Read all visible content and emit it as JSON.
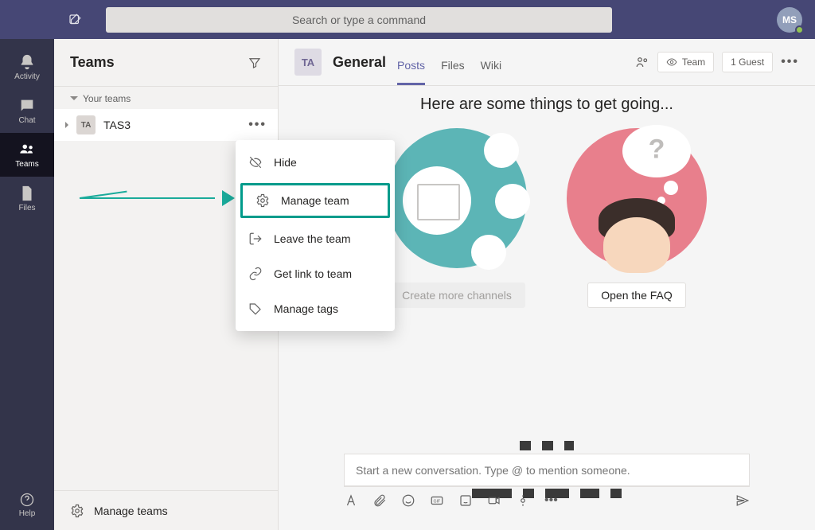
{
  "topbar": {
    "search_placeholder": "Search or type a command",
    "user_initials": "MS"
  },
  "rail": {
    "items": [
      {
        "label": "Activity",
        "icon": "bell"
      },
      {
        "label": "Chat",
        "icon": "chat"
      },
      {
        "label": "Teams",
        "icon": "teams"
      },
      {
        "label": "Files",
        "icon": "files"
      }
    ],
    "help_label": "Help"
  },
  "teams_panel": {
    "title": "Teams",
    "section_label": "Your teams",
    "team": {
      "initials": "TA",
      "name": "TAS3"
    },
    "footer_label": "Manage teams"
  },
  "channel_header": {
    "badge": "TA",
    "name": "General",
    "tabs": [
      "Posts",
      "Files",
      "Wiki"
    ],
    "visibility": "Team",
    "guest_badge": "1 Guest"
  },
  "content": {
    "heading": "Here are some things to get going...",
    "card1_button": "Create more channels",
    "card2_button": "Open the FAQ"
  },
  "compose": {
    "placeholder": "Start a new conversation. Type @ to mention someone."
  },
  "context_menu": {
    "items": [
      {
        "icon": "hide",
        "label": "Hide"
      },
      {
        "icon": "gear",
        "label": "Manage team",
        "highlighted": true
      },
      {
        "icon": "leave",
        "label": "Leave the team"
      },
      {
        "icon": "link",
        "label": "Get link to team"
      },
      {
        "icon": "tag",
        "label": "Manage tags"
      }
    ]
  }
}
